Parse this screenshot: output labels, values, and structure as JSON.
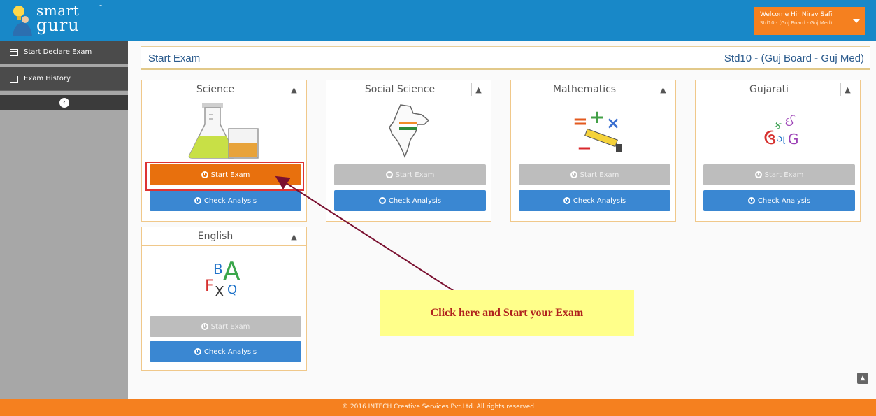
{
  "header": {
    "logo_line1": "smart",
    "logo_line2": "guru",
    "logo_tm": "™",
    "welcome_name": "Welcome Hir Nirav Safi",
    "welcome_detail": "Std10 - (Guj Board - Guj Med)"
  },
  "sidebar": {
    "items": [
      {
        "label": "Start Declare Exam"
      },
      {
        "label": "Exam History"
      }
    ],
    "collapse_label": "‹"
  },
  "main": {
    "title": "Start Exam",
    "std_info": "Std10 - (Guj Board - Guj Med)",
    "cards": [
      {
        "subject": "Science",
        "start_label": "Start Exam",
        "check_label": "Check Analysis",
        "start_enabled": true,
        "icon": "science-beaker-icon"
      },
      {
        "subject": "Social Science",
        "start_label": "Start Exam",
        "check_label": "Check Analysis",
        "start_enabled": false,
        "icon": "india-map-icon"
      },
      {
        "subject": "Mathematics",
        "start_label": "Start Exam",
        "check_label": "Check Analysis",
        "start_enabled": false,
        "icon": "math-symbols-icon"
      },
      {
        "subject": "Gujarati",
        "start_label": "Start Exam",
        "check_label": "Check Analysis",
        "start_enabled": false,
        "icon": "gujarati-letters-icon"
      },
      {
        "subject": "English",
        "start_label": "Start Exam",
        "check_label": "Check Analysis",
        "start_enabled": false,
        "icon": "abc-letters-icon"
      }
    ],
    "callout_text": "Click here and Start your Exam",
    "gujarati_glyphs": [
      "ક",
      "ઈ",
      "ઉ",
      "ગ",
      "G"
    ],
    "english_glyphs": [
      "B",
      "A",
      "F",
      "X",
      "Q"
    ],
    "math_glyphs": [
      "=",
      "+",
      "×",
      "−"
    ]
  },
  "footer": {
    "copyright": "© 2016 INTECH Creative Services Pvt.Ltd. All rights reserved"
  },
  "colors": {
    "header_blue": "#1888c8",
    "accent_orange": "#f5801f",
    "start_active": "#e8700d",
    "check_blue": "#3a87d2",
    "title_blue": "#2a5a8c",
    "callout_yellow": "#ffff8a",
    "callout_red": "#b0221e"
  }
}
